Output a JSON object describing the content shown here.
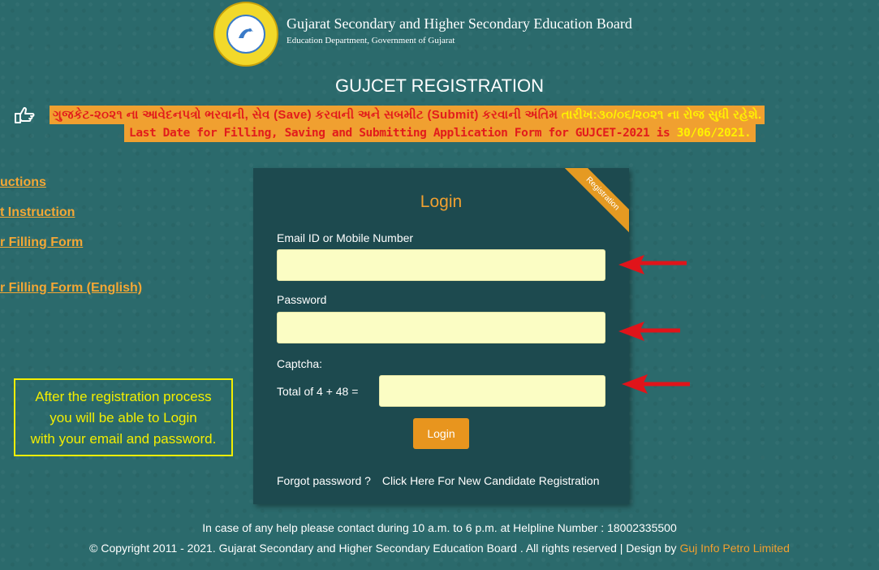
{
  "header": {
    "board_name": "Gujarat Secondary and Higher Secondary Education Board",
    "department": "Education Department, Government of Gujarat",
    "logo_icon": "board-emblem-icon"
  },
  "page_title": "GUJCET REGISTRATION",
  "notice": {
    "icon": "pointing-hand-icon",
    "gujarati_text": "ગુજકેટ-૨૦૨૧ ના આવેદનપત્રો ભરવાની, સેવ (Save) કરવાની અને સબમીટ (Submit) કરવાની અંતિમ",
    "gujarati_date": "તારીખ:૩૦/૦૬/૨૦૨૧ ના રોજ સુધી રહેશે.",
    "english_text": "Last Date for Filling, Saving and Submitting Application Form for GUJCET-2021 is",
    "english_date": "30/06/2021."
  },
  "side_links": [
    {
      "label": "uctions"
    },
    {
      "label": "t Instruction"
    },
    {
      "label": "r Filling Form"
    },
    {
      "label": "r Filling Form (English)"
    }
  ],
  "info_box": {
    "line1": "After the registration process",
    "line2": "you will be able to Login",
    "line3": "with your email and password."
  },
  "login": {
    "ribbon": "Registration",
    "title": "Login",
    "email_label": "Email ID or Mobile Number",
    "email_value": "",
    "password_label": "Password",
    "password_value": "",
    "captcha_label": "Captcha:",
    "captcha_question": "Total of 4 + 48 =",
    "captcha_value": "",
    "button": "Login",
    "forgot": "Forgot password ?",
    "register": "Click Here For New Candidate Registration"
  },
  "footer": {
    "help": "In case of any help please contact during 10 a.m. to 6 p.m. at Helpline Number : 18002335500",
    "copyright": "© Copyright 2011 - 2021. Gujarat Secondary and Higher Secondary Education Board . All rights reserved | Design by",
    "designer": "Guj Info Petro Limited"
  },
  "colors": {
    "background": "#2b6a6c",
    "accent": "#f0a030",
    "notice_text": "#e21c1c",
    "highlight": "#fff200",
    "input_bg": "#fbfdc4",
    "arrow": "#e0141a"
  }
}
